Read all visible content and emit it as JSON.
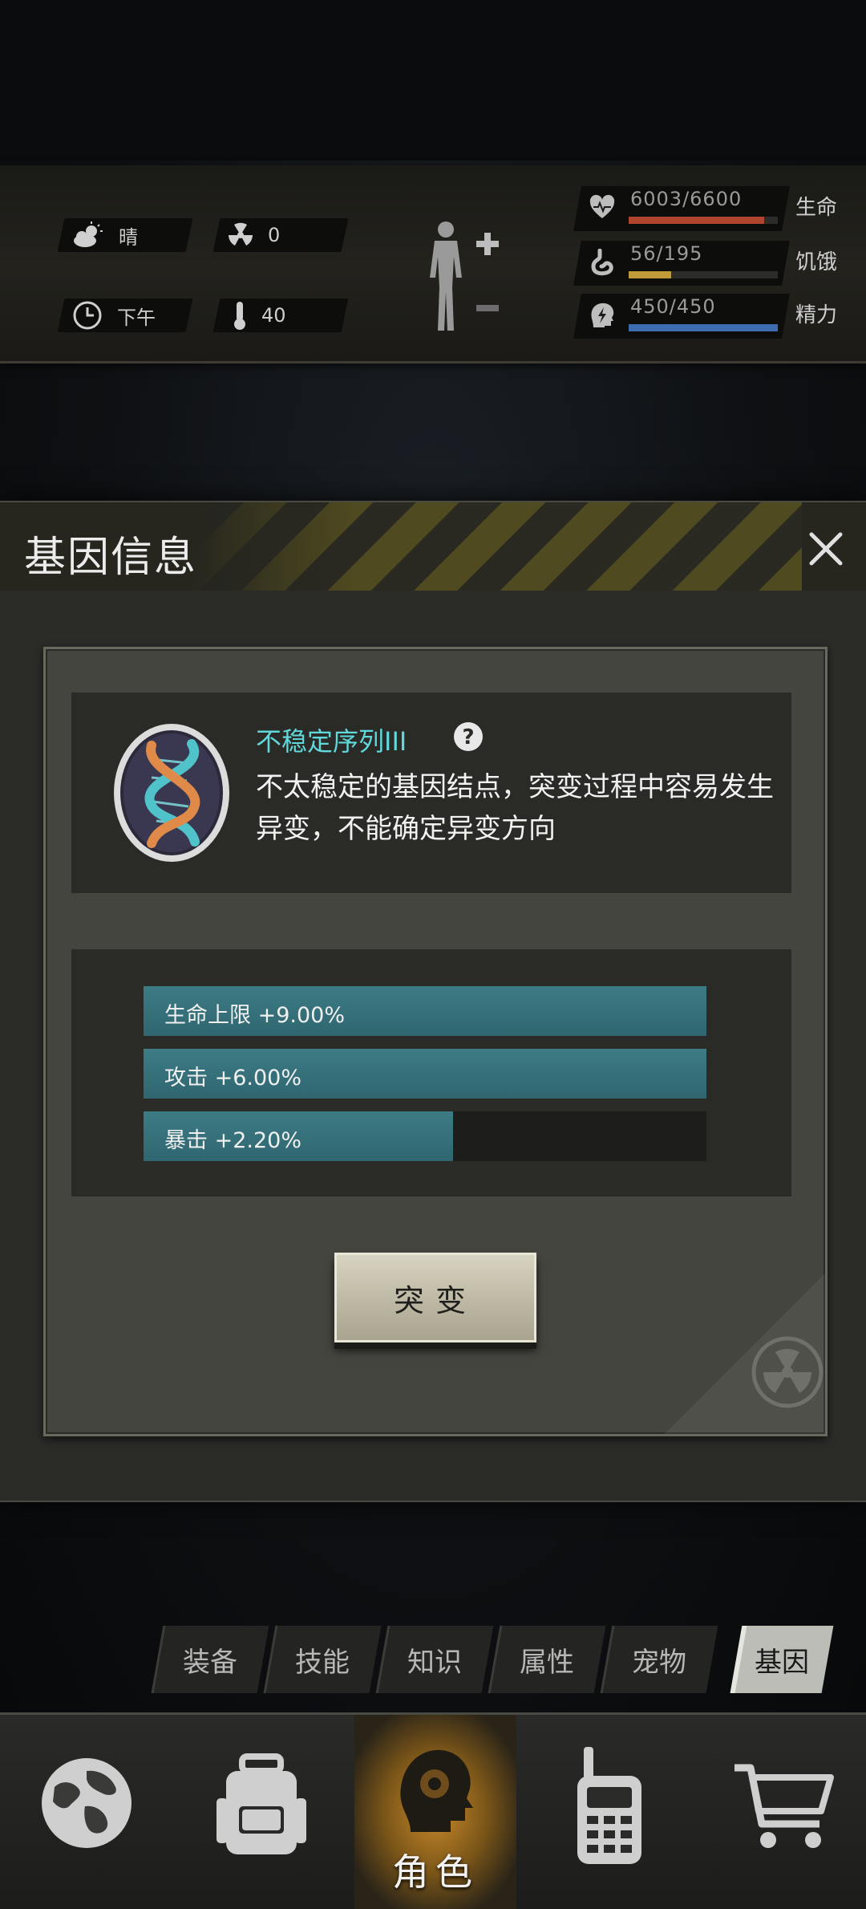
{
  "hud": {
    "weather": "晴",
    "radiation": "0",
    "time_of_day": "下午",
    "temperature": "40",
    "stats": [
      {
        "label": "生命",
        "value": "6003/6600",
        "fraction": 0.909,
        "color": "#b0452f",
        "icon": "heart-icon"
      },
      {
        "label": "饥饿",
        "value": "56/195",
        "fraction": 0.287,
        "color": "#c19a39",
        "icon": "stomach-icon"
      },
      {
        "label": "精力",
        "value": "450/450",
        "fraction": 1.0,
        "color": "#3e6cb0",
        "icon": "lightning-head-icon"
      }
    ]
  },
  "dialog": {
    "title": "基因信息",
    "gene_name": "不稳定序列III",
    "gene_desc": "不太稳定的基因结点，突变过程中容易发生异变，不能确定异变方向",
    "bonuses": [
      {
        "text": "生命上限 +9.00%",
        "fraction": 1.0
      },
      {
        "text": "攻击 +6.00%",
        "fraction": 1.0
      },
      {
        "text": "暴击 +2.20%",
        "fraction": 0.55
      }
    ],
    "mutate_label": "突变"
  },
  "tabs": [
    "装备",
    "技能",
    "知识",
    "属性",
    "宠物",
    "基因"
  ],
  "active_tab": "基因",
  "nav": {
    "active_label": "角色",
    "items": [
      "globe-icon",
      "backpack-icon",
      "character-head-icon",
      "walkie-talkie-icon",
      "shopping-cart-icon"
    ]
  }
}
